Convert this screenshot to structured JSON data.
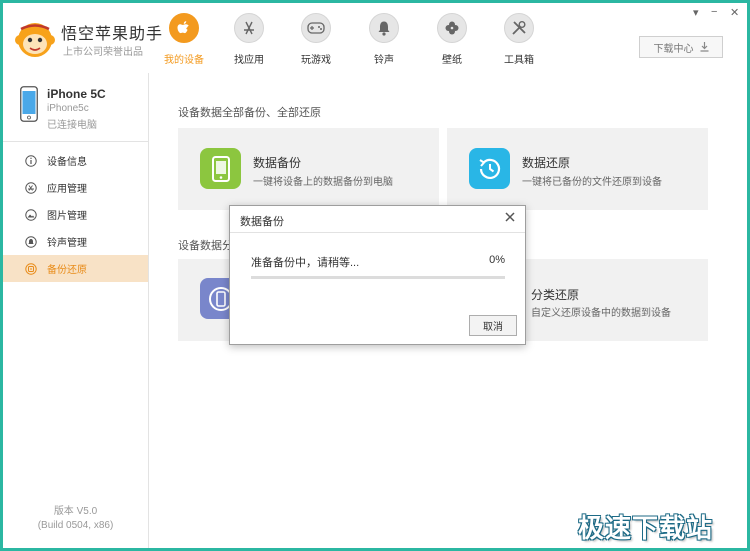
{
  "app": {
    "title": "悟空苹果助手",
    "subtitle": "上市公司荣誉出品"
  },
  "window_controls": {
    "menu_icon": "▾",
    "minimize_icon": "−",
    "close_icon": "✕"
  },
  "nav": {
    "items": [
      {
        "label": "我的设备",
        "icon": "apple-icon",
        "active": true
      },
      {
        "label": "找应用",
        "icon": "app-store-icon",
        "active": false
      },
      {
        "label": "玩游戏",
        "icon": "gamepad-icon",
        "active": false
      },
      {
        "label": "铃声",
        "icon": "bell-icon",
        "active": false
      },
      {
        "label": "壁纸",
        "icon": "clover-icon",
        "active": false
      },
      {
        "label": "工具箱",
        "icon": "tools-icon",
        "active": false
      }
    ]
  },
  "download_center": {
    "label": "下载中心"
  },
  "device": {
    "name": "iPhone 5C",
    "model": "iPhone5c",
    "status": "已连接电脑"
  },
  "sidebar": {
    "items": [
      {
        "label": "设备信息",
        "icon": "info-icon"
      },
      {
        "label": "应用管理",
        "icon": "apps-icon"
      },
      {
        "label": "图片管理",
        "icon": "picture-icon"
      },
      {
        "label": "铃声管理",
        "icon": "bell-icon"
      },
      {
        "label": "备份还原",
        "icon": "backup-icon"
      }
    ],
    "active_index": 4
  },
  "version": {
    "line1": "版本 V5.0",
    "line2": "(Build 0504, x86)"
  },
  "main": {
    "section1_title": "设备数据全部备份、全部还原",
    "section2_title": "设备数据分",
    "cards": [
      {
        "title": "数据备份",
        "desc": "一键将设备上的数据备份到电脑",
        "color": "#8cc63f"
      },
      {
        "title": "数据还原",
        "desc": "一键将已备份的文件还原到设备",
        "color": "#29b6e6"
      },
      {
        "title": "",
        "desc": "",
        "color": "#7986cb"
      },
      {
        "title": "分类还原",
        "desc": "自定义还原设备中的数据到设备",
        "color": "#29b6e6"
      }
    ]
  },
  "dialog": {
    "title": "数据备份",
    "message": "准备备份中，请稍等...",
    "percent_text": "0%",
    "progress": 0,
    "cancel_label": "取消"
  },
  "watermark": "极速下载站",
  "colors": {
    "accent": "#f39a1f",
    "frame": "#2bb7a2"
  }
}
